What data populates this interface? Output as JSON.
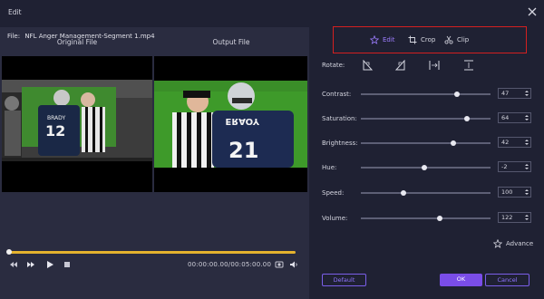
{
  "window": {
    "title": "Edit"
  },
  "file": {
    "label": "File:",
    "name": "NFL Anger Management-Segment 1.mp4"
  },
  "preview": {
    "original_label": "Original File",
    "output_label": "Output File",
    "jersey_number": "12",
    "jersey_name": "BRADY"
  },
  "playback": {
    "timecode": "00:00:00.00/00:05:00.00",
    "progress": 0.0
  },
  "tabs": [
    {
      "label": "Edit",
      "icon": "edit-star-icon",
      "active": true
    },
    {
      "label": "Crop",
      "icon": "crop-icon",
      "active": false
    },
    {
      "label": "Clip",
      "icon": "scissors-icon",
      "active": false
    }
  ],
  "rotate": {
    "label": "Rotate:"
  },
  "adjustments": [
    {
      "label": "Contrast:",
      "value": "47",
      "level": 0.74
    },
    {
      "label": "Saturation:",
      "value": "64",
      "level": 0.82
    },
    {
      "label": "Brightness:",
      "value": "42",
      "level": 0.71
    },
    {
      "label": "Hue:",
      "value": "-2",
      "level": 0.49
    },
    {
      "label": "Speed:",
      "value": "100",
      "level": 0.33
    },
    {
      "label": "Volume:",
      "value": "122",
      "level": 0.61
    }
  ],
  "advance": {
    "label": "Advance"
  },
  "buttons": {
    "default": "Default",
    "ok": "OK",
    "cancel": "Cancel"
  },
  "colors": {
    "accent": "#7a4de8",
    "progress": "#e4b22e",
    "highlight_box": "#d42020"
  }
}
